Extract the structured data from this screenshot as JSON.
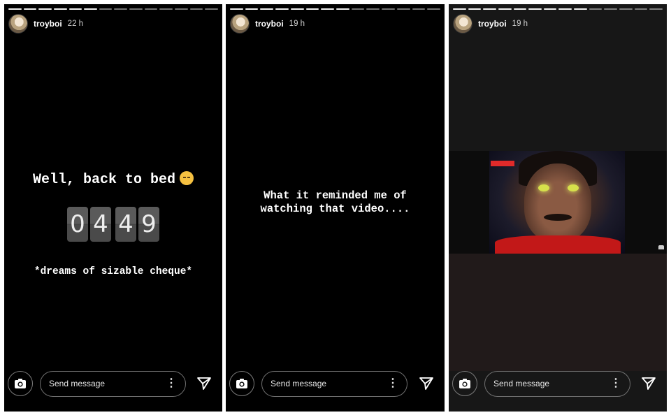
{
  "stories": [
    {
      "username": "troyboi",
      "time_ago": "22 h",
      "title": "Well, back to bed",
      "clock_digits": [
        "0",
        "4",
        "4",
        "9"
      ],
      "subtitle": "*dreams of sizable cheque*",
      "message_placeholder": "Send message"
    },
    {
      "username": "troyboi",
      "time_ago": "19 h",
      "text_line1": "What it reminded me of",
      "text_line2": "watching that video....",
      "message_placeholder": "Send message"
    },
    {
      "username": "troyboi",
      "time_ago": "19 h",
      "message_placeholder": "Send message"
    }
  ],
  "icons": {
    "camera": "camera-icon",
    "send": "send-icon",
    "more": "more-vertical-icon",
    "emoji": "sleeping-face-emoji"
  },
  "colors": {
    "story_background": "#000000",
    "text": "#ffffff",
    "video_shirt": "#c21818"
  }
}
